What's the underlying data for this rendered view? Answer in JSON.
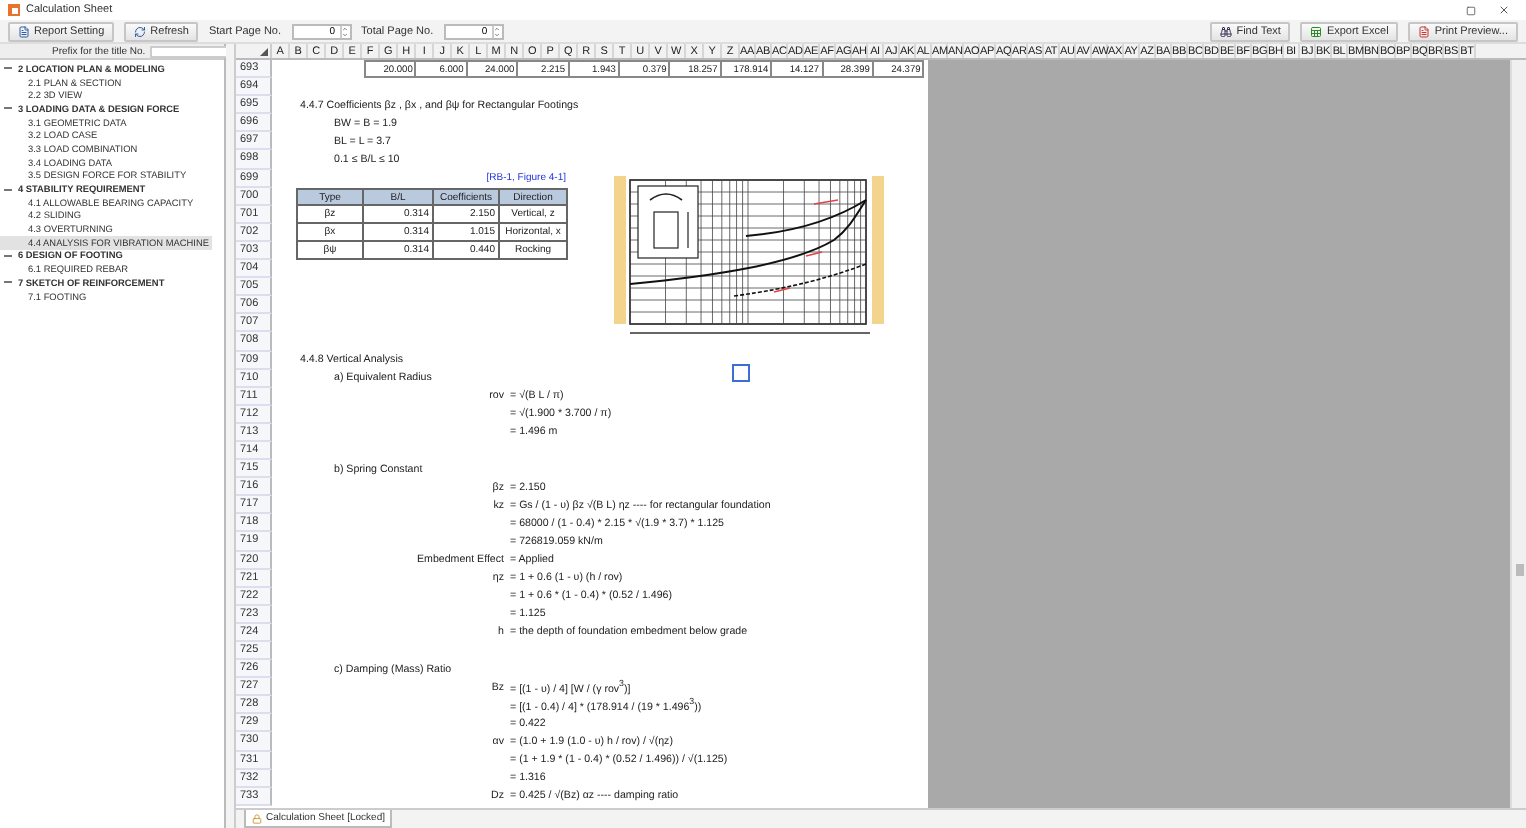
{
  "window": {
    "title": "Calculation Sheet"
  },
  "toolbar": {
    "left_buttons": [
      {
        "label": "Report Setting"
      },
      {
        "label": "Refresh"
      }
    ],
    "spinners": [
      {
        "label": "Start Page No.",
        "value": "0"
      },
      {
        "label": "Total Page No.",
        "value": "0"
      }
    ],
    "right_buttons": [
      {
        "label": "Find Text"
      },
      {
        "label": "Export Excel"
      },
      {
        "label": "Print Preview..."
      }
    ]
  },
  "sidebar": {
    "prefix_label": "Prefix for the title No.",
    "tree": [
      {
        "label": "2 LOCATION PLAN & MODELING",
        "expanded": true,
        "selected": false,
        "children": [
          {
            "label": "2.1 PLAN & SECTION",
            "selected": false
          },
          {
            "label": "2.2 3D VIEW",
            "selected": false
          }
        ]
      },
      {
        "label": "3 LOADING DATA & DESIGN FORCE",
        "expanded": true,
        "selected": false,
        "children": [
          {
            "label": "3.1 GEOMETRIC DATA",
            "selected": false
          },
          {
            "label": "3.2 LOAD CASE",
            "selected": false
          },
          {
            "label": "3.3 LOAD COMBINATION",
            "selected": false
          },
          {
            "label": "3.4 LOADING DATA",
            "selected": false
          },
          {
            "label": "3.5 DESIGN FORCE FOR STABILITY",
            "selected": false
          }
        ]
      },
      {
        "label": "4 STABILITY REQUIREMENT",
        "expanded": true,
        "selected": false,
        "children": [
          {
            "label": "4.1 ALLOWABLE BEARING CAPACITY",
            "selected": false
          },
          {
            "label": "4.2 SLIDING",
            "selected": false
          },
          {
            "label": "4.3 OVERTURNING",
            "selected": false
          },
          {
            "label": "4.4 ANALYSIS FOR VIBRATION MACHINE",
            "selected": true
          }
        ]
      },
      {
        "label": "6 DESIGN OF FOOTING",
        "expanded": true,
        "selected": false,
        "children": [
          {
            "label": "6.1 REQUIRED REBAR",
            "selected": false
          }
        ]
      },
      {
        "label": "7 SKETCH OF REINFORCEMENT",
        "expanded": true,
        "selected": false,
        "children": [
          {
            "label": "7.1 FOOTING",
            "selected": false
          }
        ]
      }
    ]
  },
  "sheet": {
    "columns": [
      "A",
      "B",
      "C",
      "D",
      "E",
      "F",
      "G",
      "H",
      "I",
      "J",
      "K",
      "L",
      "M",
      "N",
      "O",
      "P",
      "Q",
      "R",
      "S",
      "T",
      "U",
      "V",
      "W",
      "X",
      "Y",
      "Z",
      "AA",
      "AB",
      "AC",
      "AD",
      "AE",
      "AF",
      "AG",
      "AH",
      "AI",
      "AJ",
      "AK",
      "AL",
      "AM",
      "AN",
      "AO",
      "AP",
      "AQ",
      "AR",
      "AS",
      "AT",
      "AU",
      "AV",
      "AW",
      "AX",
      "AY",
      "AZ",
      "BA",
      "BB",
      "BC",
      "BD",
      "BE",
      "BF",
      "BG",
      "BH",
      "BI",
      "BJ",
      "BK",
      "BL",
      "BM",
      "BN",
      "BO",
      "BP",
      "BQ",
      "BR",
      "BS",
      "BT"
    ],
    "rows": [
      {
        "no": "693",
        "kind": "values",
        "cells": [
          "20.000",
          "6.000",
          "24.000",
          "2.215",
          "1.943",
          "0.379",
          "18.257",
          "178.914",
          "14.127",
          "28.399",
          "24.379"
        ]
      },
      {
        "no": "694",
        "kind": "blank"
      },
      {
        "no": "695",
        "kind": "section",
        "text": "4.4.7 Coefficients βz , βx , and βψ for Rectangular Footings"
      },
      {
        "no": "696",
        "kind": "note",
        "text": "BW = B = 1.9"
      },
      {
        "no": "697",
        "kind": "note",
        "text": "BL = L = 3.7"
      },
      {
        "no": "698",
        "kind": "note",
        "text": "0.1 ≤ B/L ≤ 10"
      },
      {
        "no": "699",
        "kind": "reference",
        "text": "[RB-1, Figure 4-1]"
      },
      {
        "no": "700",
        "kind": "table_header",
        "cells": [
          "Type",
          "B/L",
          "Coefficients",
          "Direction"
        ]
      },
      {
        "no": "701",
        "kind": "table_row",
        "cells": [
          "βz",
          "0.314",
          "2.150",
          "Vertical, z"
        ]
      },
      {
        "no": "702",
        "kind": "table_row",
        "cells": [
          "βx",
          "0.314",
          "1.015",
          "Horizontal, x"
        ]
      },
      {
        "no": "703",
        "kind": "table_row",
        "cells": [
          "βψ",
          "0.314",
          "0.440",
          "Rocking"
        ]
      },
      {
        "no": "704",
        "kind": "blank"
      },
      {
        "no": "705",
        "kind": "blank"
      },
      {
        "no": "706",
        "kind": "blank"
      },
      {
        "no": "707",
        "kind": "blank"
      },
      {
        "no": "708",
        "kind": "blank"
      },
      {
        "no": "709",
        "kind": "section",
        "text": "4.4.8 Vertical Analysis"
      },
      {
        "no": "710",
        "kind": "subsection",
        "text": "a) Equivalent Radius"
      },
      {
        "no": "711",
        "kind": "formula",
        "lhs": "rov",
        "rhs": "= √(B L / π)"
      },
      {
        "no": "712",
        "kind": "formula",
        "rhs": "= √(1.900 * 3.700 / π)"
      },
      {
        "no": "713",
        "kind": "formula",
        "rhs": "= 1.496 m"
      },
      {
        "no": "714",
        "kind": "blank"
      },
      {
        "no": "715",
        "kind": "subsection",
        "text": "b) Spring Constant"
      },
      {
        "no": "716",
        "kind": "formula",
        "lhs": "βz",
        "rhs": "= 2.150"
      },
      {
        "no": "717",
        "kind": "formula",
        "lhs": "kz",
        "rhs": "= Gs / (1 - υ) βz √(B L) ηz ---- for rectangular foundation"
      },
      {
        "no": "718",
        "kind": "formula",
        "rhs": "= 68000 / (1 - 0.4) * 2.15 * √(1.9 * 3.7) * 1.125"
      },
      {
        "no": "719",
        "kind": "formula",
        "rhs": "= 726819.059 kN/m"
      },
      {
        "no": "720",
        "kind": "formula",
        "lhs": "Embedment Effect",
        "rhs": "= Applied"
      },
      {
        "no": "721",
        "kind": "formula",
        "lhs": "ηz",
        "rhs": "= 1 + 0.6 (1 - υ) (h / rov)"
      },
      {
        "no": "722",
        "kind": "formula",
        "rhs": "= 1 + 0.6 * (1 - 0.4) * (0.52 / 1.496)"
      },
      {
        "no": "723",
        "kind": "formula",
        "rhs": "= 1.125"
      },
      {
        "no": "724",
        "kind": "formula",
        "lhs": "h",
        "rhs": "= the depth of foundation embedment below grade"
      },
      {
        "no": "725",
        "kind": "blank"
      },
      {
        "no": "726",
        "kind": "subsection",
        "text": "c) Damping (Mass) Ratio"
      },
      {
        "no": "727",
        "kind": "formula",
        "lhs": "Bz",
        "rhs": "= [(1 - υ) / 4] [W / (γ rov$^{3}$)]"
      },
      {
        "no": "728",
        "kind": "formula",
        "rhs": "= [(1 - 0.4) / 4] * (178.914 / (19 * 1.496$^{3}$))"
      },
      {
        "no": "729",
        "kind": "formula",
        "rhs": "= 0.422"
      },
      {
        "no": "730",
        "kind": "formula",
        "lhs": "αv",
        "rhs": "= (1.0 + 1.9 (1.0 - υ) h / rov) / √(ηz)"
      },
      {
        "no": "731",
        "kind": "formula",
        "rhs": "= (1 + 1.9 * (1 - 0.4) * (0.52 / 1.496)) / √(1.125)"
      },
      {
        "no": "732",
        "kind": "formula",
        "rhs": "= 1.316"
      },
      {
        "no": "733",
        "kind": "formula",
        "lhs": "Dz",
        "rhs": "= 0.425 / √(Bz) αz ---- damping ratio"
      }
    ]
  },
  "sheet_tab": {
    "label": "Calculation Sheet [Locked]"
  }
}
